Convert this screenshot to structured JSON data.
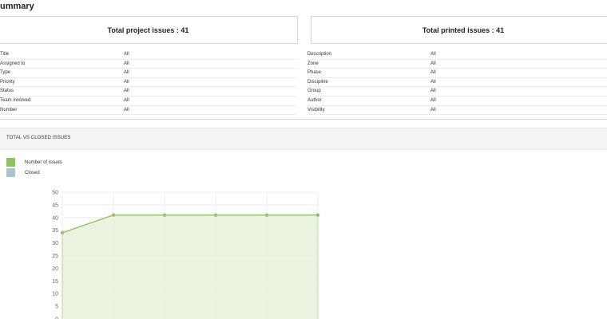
{
  "page": {
    "title": "ummary"
  },
  "totals": {
    "project": "Total project issues : 41",
    "printed": "Total printed issues : 41"
  },
  "filters_left": [
    {
      "label": "Title",
      "value": "All"
    },
    {
      "label": "Assigned to",
      "value": "All"
    },
    {
      "label": "Type",
      "value": "All"
    },
    {
      "label": "Priority",
      "value": "All"
    },
    {
      "label": "Status",
      "value": "All"
    },
    {
      "label": "Team involved",
      "value": "All"
    },
    {
      "label": "Number",
      "value": "All"
    }
  ],
  "filters_right": [
    {
      "label": "Description",
      "value": "All"
    },
    {
      "label": "Zone",
      "value": "All"
    },
    {
      "label": "Phase",
      "value": "All"
    },
    {
      "label": "Discipline",
      "value": "All"
    },
    {
      "label": "Group",
      "value": "All"
    },
    {
      "label": "Author",
      "value": "All"
    },
    {
      "label": "Visibility",
      "value": "All"
    }
  ],
  "panel": {
    "title": "TOTAL VS CLOSED ISSUES"
  },
  "legend": [
    {
      "label": "Number of issues",
      "color": "#8fc45f"
    },
    {
      "label": "Closed",
      "color": "#a9c3d3"
    }
  ],
  "chart_data": {
    "type": "area",
    "title": "TOTAL VS CLOSED ISSUES",
    "ylim": [
      0,
      50
    ],
    "yticks": [
      0,
      5,
      10,
      15,
      20,
      25,
      30,
      35,
      40,
      45,
      50
    ],
    "grid": true,
    "legend_position": "top-left",
    "series": [
      {
        "name": "Number of issues",
        "values": [
          34,
          41,
          41,
          41,
          41,
          41
        ],
        "color": "#8fc45f"
      },
      {
        "name": "Closed",
        "values": [],
        "color": "#a9c3d3"
      }
    ]
  }
}
